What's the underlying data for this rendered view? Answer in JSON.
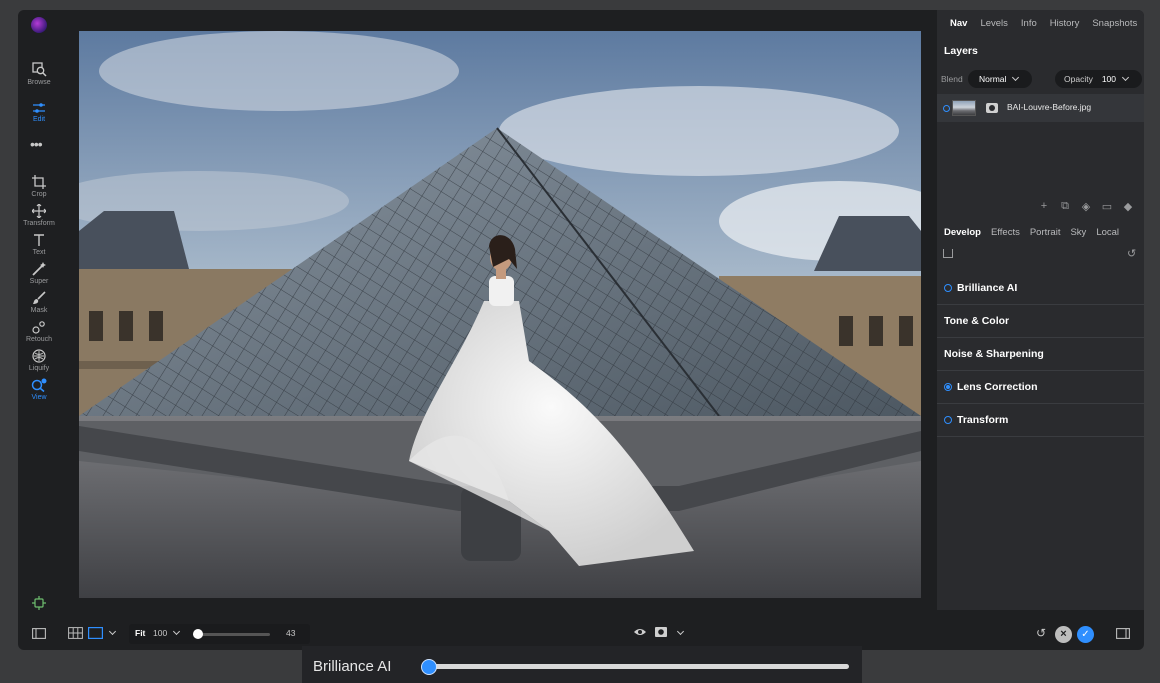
{
  "toolbar": {
    "tools": [
      {
        "label": "Browse",
        "icon": "browse-icon"
      },
      {
        "label": "Edit",
        "icon": "sliders-icon",
        "active": true
      },
      {
        "label": "Crop",
        "icon": "crop-icon"
      },
      {
        "label": "Transform",
        "icon": "move-icon"
      },
      {
        "label": "Text",
        "icon": "text-icon"
      },
      {
        "label": "Super",
        "icon": "wand-icon"
      },
      {
        "label": "Mask",
        "icon": "brush-icon"
      },
      {
        "label": "Retouch",
        "icon": "retouch-icon"
      },
      {
        "label": "Liquify",
        "icon": "liquify-icon"
      },
      {
        "label": "View",
        "icon": "zoom-icon",
        "active": true
      }
    ],
    "more_glyph": "•••"
  },
  "panel": {
    "tabs": [
      "Nav",
      "Levels",
      "Info",
      "History",
      "Snapshots"
    ],
    "active_tab": "Nav",
    "layers": {
      "title": "Layers",
      "blend_label": "Blend",
      "blend_value": "Normal",
      "opacity_label": "Opacity",
      "opacity_value": "100",
      "items": [
        {
          "name": "BAI-Louvre-Before.jpg"
        }
      ]
    },
    "develop_tabs": [
      "Develop",
      "Effects",
      "Portrait",
      "Sky",
      "Local"
    ],
    "active_develop_tab": "Develop",
    "sections": [
      {
        "label": "Brilliance AI",
        "dot": "outline"
      },
      {
        "label": "Tone & Color",
        "dot": "none"
      },
      {
        "label": "Noise & Sharpening",
        "dot": "none"
      },
      {
        "label": "Lens Correction",
        "dot": "filled"
      },
      {
        "label": "Transform",
        "dot": "outline"
      }
    ]
  },
  "bottom_bar": {
    "fit_label": "Fit",
    "zoom_value": "100",
    "slider_value": "43",
    "slider_fraction": 0.0
  },
  "caption": {
    "label": "Brilliance AI",
    "slider_fraction": 0.0
  },
  "colors": {
    "accent": "#2f8fff",
    "panel_bg": "#2a2b2e",
    "app_bg": "#1e1f21"
  }
}
